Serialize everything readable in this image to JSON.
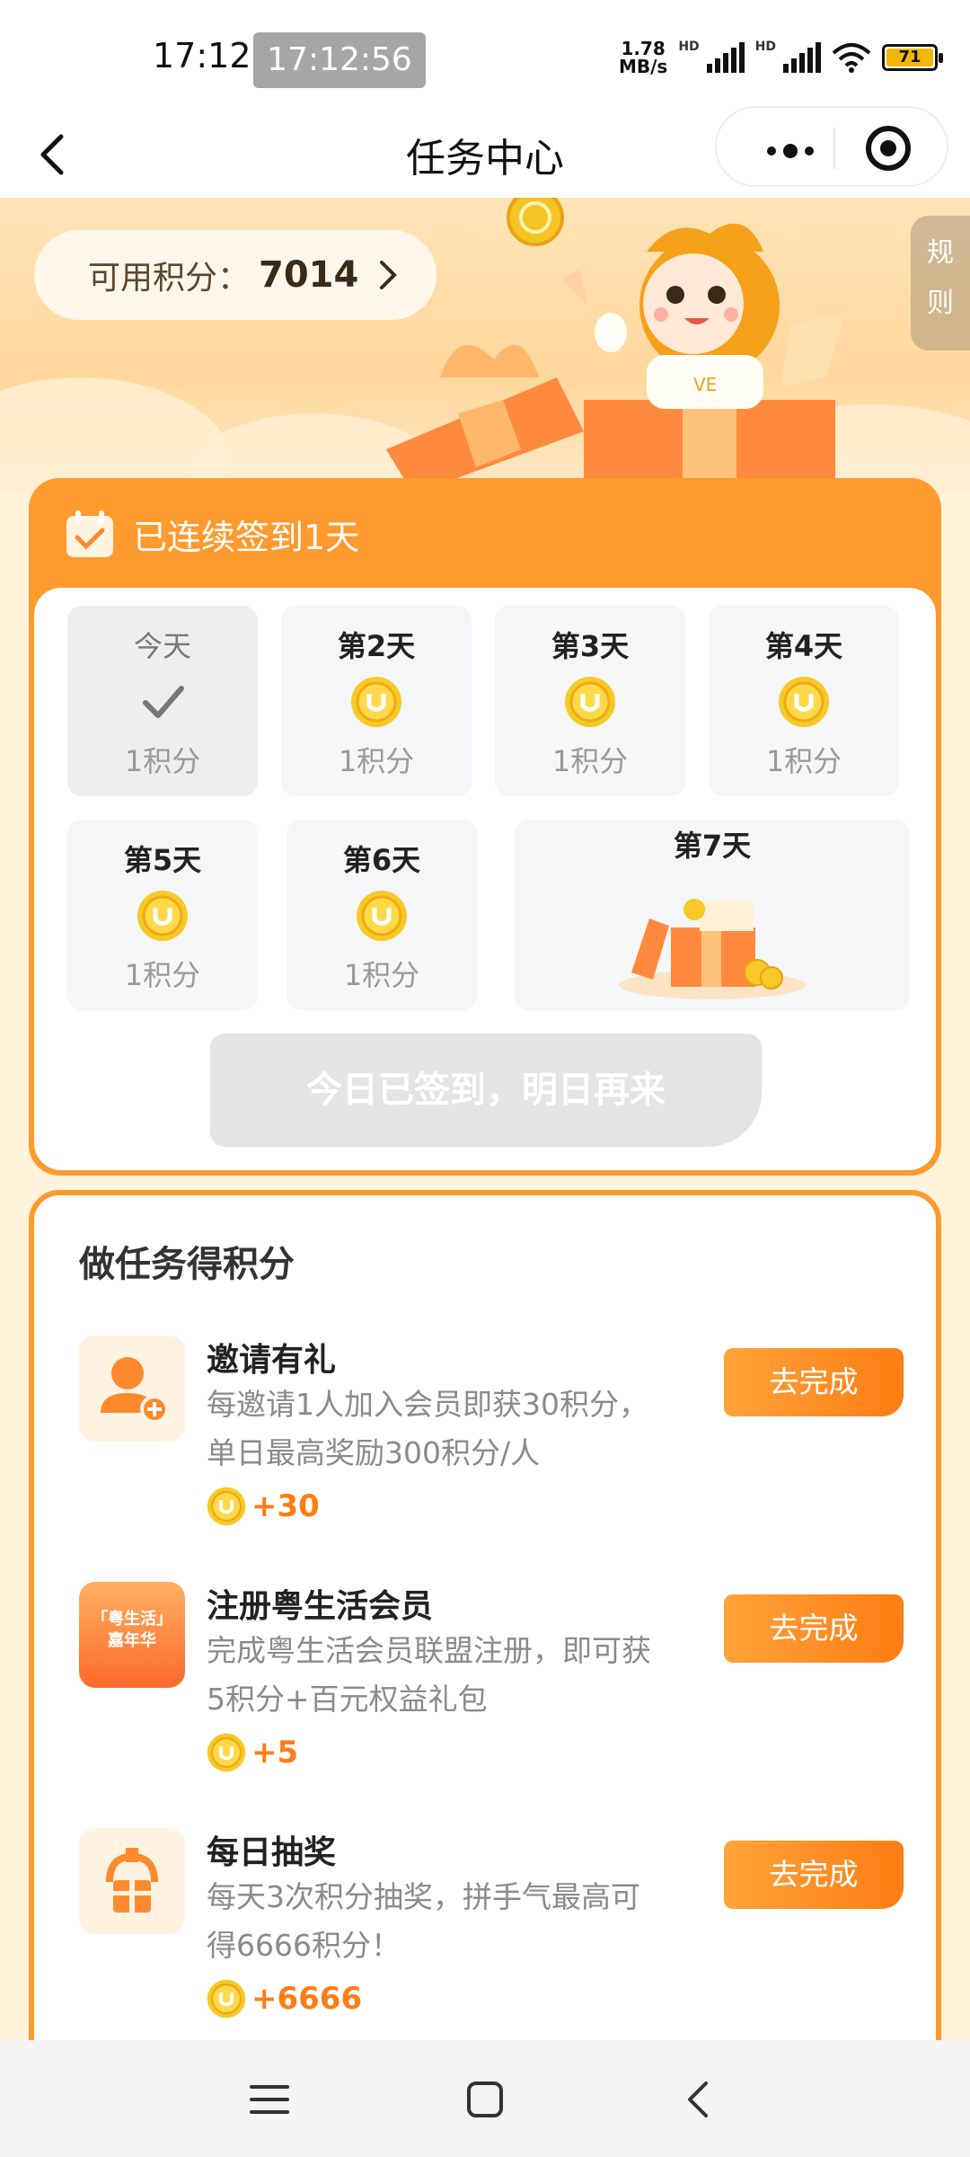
{
  "status_bar": {
    "time": "17:12",
    "time_overlay": "17:12:56",
    "net_speed_value": "1.78",
    "net_speed_unit": "MB/s",
    "sim1": "HD",
    "sim2": "HD",
    "battery": "71"
  },
  "nav": {
    "title": "任务中心"
  },
  "hero": {
    "points_label": "可用积分：",
    "points_value": "7014",
    "rules_line1": "规",
    "rules_line2": "则"
  },
  "checkin": {
    "title": "已连续签到1天",
    "days": [
      {
        "label": "今天",
        "points": "1积分",
        "state": "done"
      },
      {
        "label": "第2天",
        "points": "1积分",
        "state": "pending"
      },
      {
        "label": "第3天",
        "points": "1积分",
        "state": "pending"
      },
      {
        "label": "第4天",
        "points": "1积分",
        "state": "pending"
      },
      {
        "label": "第5天",
        "points": "1积分",
        "state": "pending"
      },
      {
        "label": "第6天",
        "points": "1积分",
        "state": "pending"
      },
      {
        "label": "第7天",
        "state": "gift"
      }
    ],
    "button_label": "今日已签到，明日再来"
  },
  "tasks": {
    "heading": "做任务得积分",
    "items": [
      {
        "name": "邀请有礼",
        "desc": "每邀请1人加入会员即获30积分，单日最高奖励300积分/人",
        "reward": "+30",
        "button": "去完成",
        "icon": "add-user-icon"
      },
      {
        "name": "注册粤生活会员",
        "desc": "完成粤生活会员联盟注册，即可获5积分+百元权益礼包",
        "reward": "+5",
        "button": "去完成",
        "icon": "promo-thumbnail",
        "icon_text_1": "「粤生活」",
        "icon_text_2": "嘉年华"
      },
      {
        "name": "每日抽奖",
        "desc": "每天3次积分抽奖，拼手气最高可得6666积分！",
        "reward": "+6666",
        "button": "去完成",
        "icon": "gift-lottery-icon"
      }
    ]
  },
  "colors": {
    "accent": "#ff9a2e",
    "reward": "#ff7d14",
    "background": "#fff3dc"
  }
}
